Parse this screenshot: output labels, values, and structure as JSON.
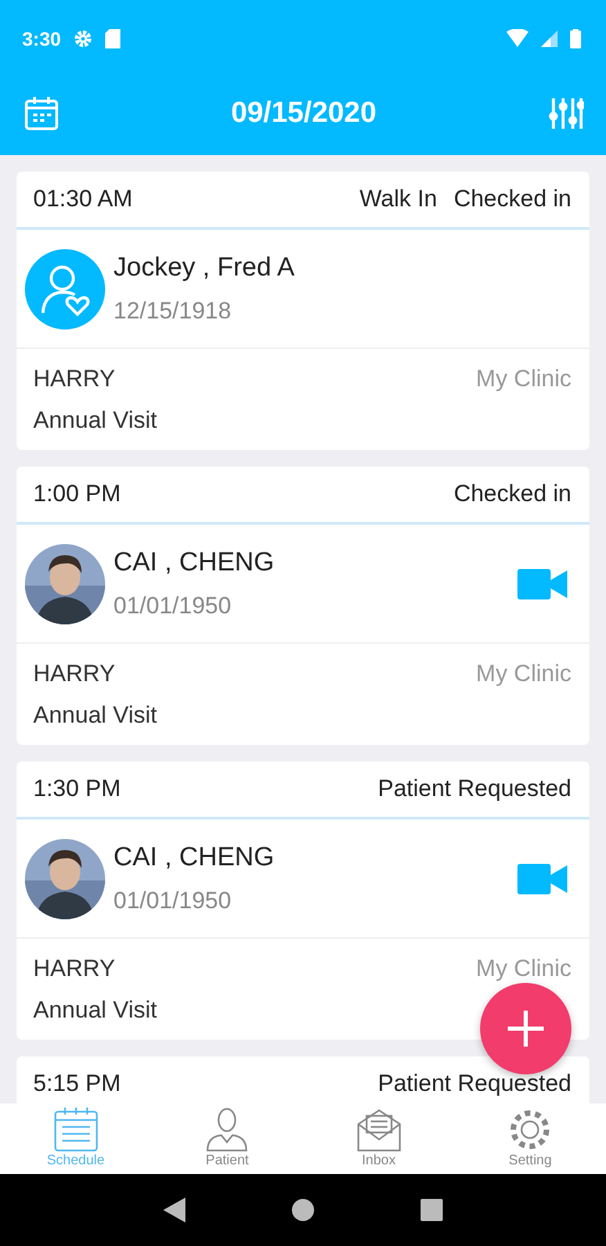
{
  "status_bar": {
    "time": "3:30"
  },
  "app_bar": {
    "title": "09/15/2020"
  },
  "appointments": [
    {
      "time": "01:30 AM",
      "visit_type": "Walk In",
      "status": "Checked in",
      "patient": "Jockey , Fred A",
      "dob": "12/15/1918",
      "avatar": {
        "kind": "icon"
      },
      "video": false,
      "provider": "HARRY",
      "clinic": "My Clinic",
      "reason": "Annual Visit"
    },
    {
      "time": "1:00 PM",
      "status": "Checked in",
      "patient": "CAI , CHENG",
      "dob": "01/01/1950",
      "video": true,
      "provider": "HARRY",
      "clinic": "My Clinic",
      "reason": "Annual Visit"
    },
    {
      "time": "1:30 PM",
      "status": "Patient Requested",
      "patient": "CAI , CHENG",
      "dob": "01/01/1950",
      "video": true,
      "provider": "HARRY",
      "clinic": "My Clinic",
      "reason": "Annual Visit"
    },
    {
      "time": "5:15 PM",
      "status": "Patient Requested"
    }
  ],
  "tabs": [
    {
      "label": "Schedule",
      "selected": true
    },
    {
      "label": "Patient",
      "selected": false
    },
    {
      "label": "Inbox",
      "selected": false
    },
    {
      "label": "Setting",
      "selected": false
    }
  ]
}
